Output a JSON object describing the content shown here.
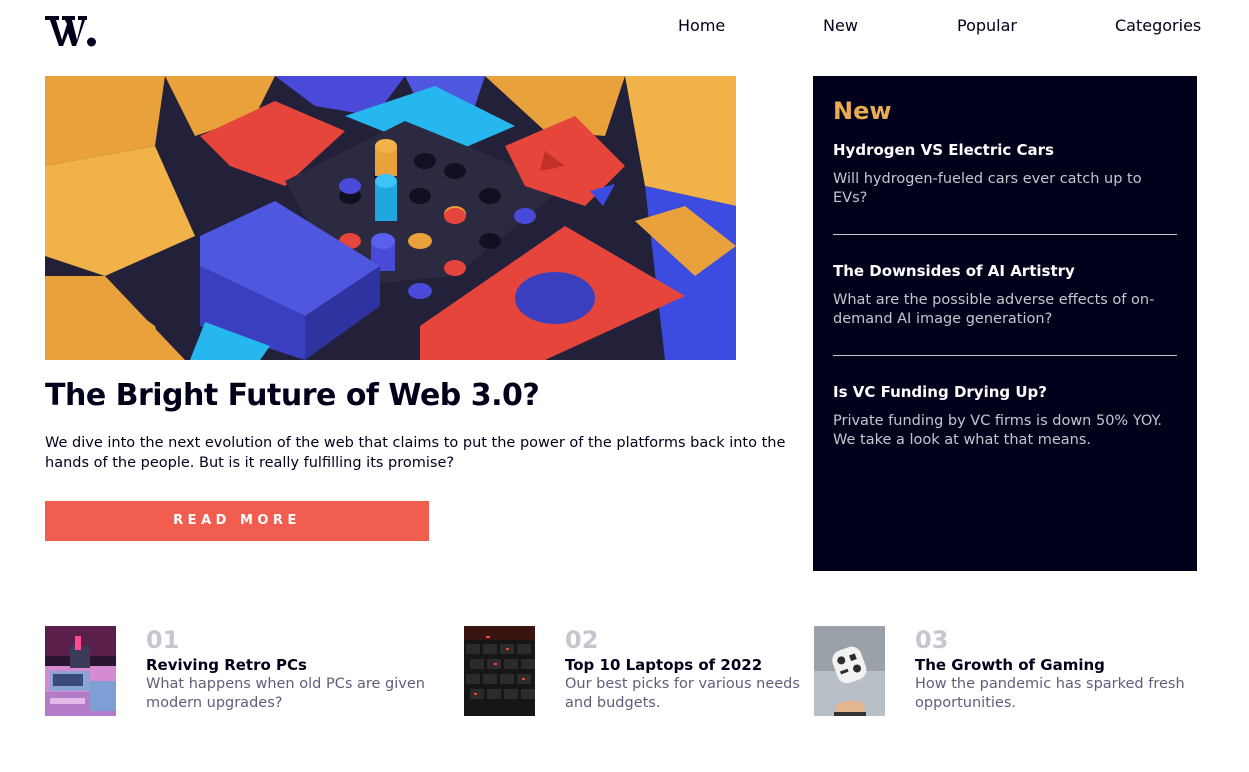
{
  "header": {
    "logo_text": "W.",
    "nav": [
      "Home",
      "New",
      "Popular",
      "Categories"
    ]
  },
  "hero": {
    "title": "The Bright Future of Web 3.0?",
    "description": "We dive into the next evolution of the web that claims to put the power of the platforms back into the hands of the people. But is it really fulfilling its promise?",
    "button_label": "READ MORE"
  },
  "new_panel": {
    "heading": "New",
    "items": [
      {
        "title": "Hydrogen VS Electric Cars",
        "description": "Will hydrogen-fueled cars ever catch up to EVs?"
      },
      {
        "title": "The Downsides of AI Artistry",
        "description": "What are the possible adverse effects of on-demand AI image generation?"
      },
      {
        "title": "Is VC Funding Drying Up?",
        "description": "Private funding by VC firms is down 50% YOY. We take a look at what that means."
      }
    ]
  },
  "cards": [
    {
      "number": "01",
      "title": "Reviving Retro PCs",
      "description": "What happens when old PCs are given modern upgrades?"
    },
    {
      "number": "02",
      "title": "Top 10 Laptops of 2022",
      "description": "Our best picks for various needs and budgets."
    },
    {
      "number": "03",
      "title": "The Growth of Gaming",
      "description": "How the pandemic has sparked fresh opportunities."
    }
  ],
  "colors": {
    "dark_navy": "#00001a",
    "soft_red": "#f15e50",
    "soft_orange": "#e9ab53",
    "grayish_blue": "#c5c6ce",
    "dark_grayish_blue": "#5d5f79"
  }
}
